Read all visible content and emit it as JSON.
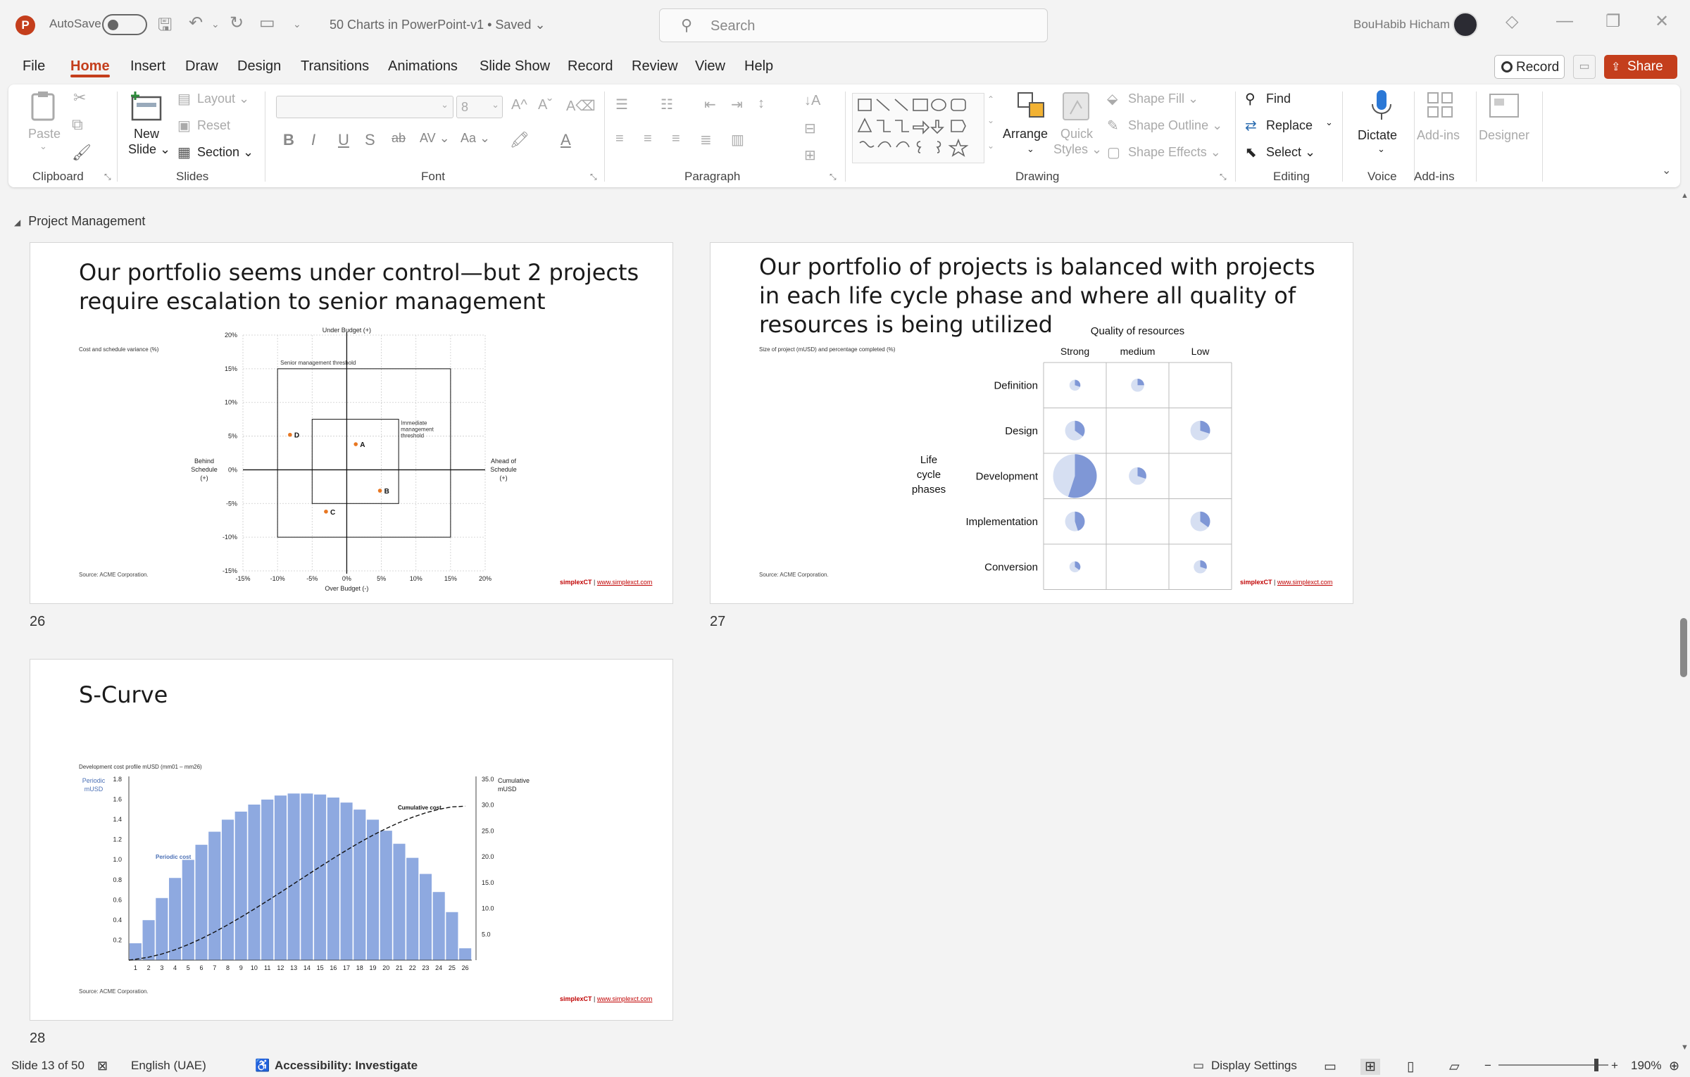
{
  "app": {
    "autosave_label": "AutoSave",
    "doc_title": "50 Charts in PowerPoint-v1 • Saved ⌄",
    "search_placeholder": "Search",
    "user_name": "BouHabib Hicham"
  },
  "menu": [
    "File",
    "Home",
    "Insert",
    "Draw",
    "Design",
    "Transitions",
    "Animations",
    "Slide Show",
    "Record",
    "Review",
    "View",
    "Help"
  ],
  "actions": {
    "record": "Record",
    "share": "Share"
  },
  "ribbon": {
    "clipboard": {
      "label": "Clipboard",
      "paste": "Paste"
    },
    "slides": {
      "label": "Slides",
      "new_slide_1": "New",
      "new_slide_2": "Slide ⌄",
      "layout": "Layout ⌄",
      "reset": "Reset",
      "section": "Section ⌄"
    },
    "font": {
      "label": "Font",
      "size": "8",
      "grow": "A^",
      "shrink": "Aˇ",
      "clear": "A⌫",
      "bold": "B",
      "italic": "I",
      "underline": "U",
      "shadow": "S",
      "strike": "ab",
      "spacing": "AV ⌄",
      "case": "Aa ⌄"
    },
    "paragraph": {
      "label": "Paragraph"
    },
    "drawing": {
      "label": "Drawing",
      "arrange": "Arrange",
      "quick_1": "Quick",
      "quick_2": "Styles ⌄",
      "fill": "Shape Fill ⌄",
      "outline": "Shape Outline ⌄",
      "effects": "Shape Effects ⌄"
    },
    "editing": {
      "label": "Editing",
      "find": "Find",
      "replace": "Replace",
      "select": "Select ⌄"
    },
    "voice": {
      "label": "Voice",
      "dictate": "Dictate"
    },
    "addins": {
      "label": "Add-ins",
      "addins": "Add-ins"
    },
    "designer": {
      "designer": "Designer"
    }
  },
  "section_title": "Project Management",
  "slides": [
    {
      "number": "26",
      "title_line1": "Our portfolio seems under control—but 2 projects",
      "title_line2": "require escalation to senior management",
      "subtitle": "Cost and schedule variance (%)",
      "source": "Source: ACME Corporation.",
      "chart_data": {
        "type": "scatter",
        "top_label": "Under Budget (+)",
        "bottom_label": "Over Budget (-)",
        "left_label": [
          "Behind",
          "Schedule",
          "(+)"
        ],
        "right_label": [
          "Ahead of",
          "Schedule",
          "(+)"
        ],
        "senior_threshold": "Senior management threshold",
        "immediate_threshold": [
          "Immediate",
          "management",
          "threshold"
        ],
        "x_ticks": [
          "-15%",
          "-10%",
          "-5%",
          "0%",
          "5%",
          "10%",
          "15%",
          "20%"
        ],
        "y_ticks": [
          "20%",
          "15%",
          "10%",
          "5%",
          "0%",
          "-5%",
          "-10%",
          "-15%"
        ],
        "xlim": [
          -15,
          20
        ],
        "ylim": [
          -15,
          20
        ],
        "senior_box": {
          "x": [
            -10,
            15
          ],
          "y": [
            -10,
            15
          ]
        },
        "immediate_box": {
          "x": [
            -5,
            7.5
          ],
          "y": [
            -5,
            7.5
          ]
        },
        "points": [
          {
            "label": "A",
            "x": 1.3,
            "y": 3.8
          },
          {
            "label": "B",
            "x": 4.8,
            "y": -3.1
          },
          {
            "label": "C",
            "x": -3.0,
            "y": -6.2
          },
          {
            "label": "D",
            "x": -8.2,
            "y": 5.2
          }
        ]
      }
    },
    {
      "number": "27",
      "title_line1": "Our portfolio of projects is balanced with projects",
      "title_line2": "in each life cycle phase and where all quality of",
      "title_line3": "resources is being utilized",
      "subtitle": "Size of project (mUSD) and percentage completed (%)",
      "source": "Source: ACME Corporation.",
      "chart_data": {
        "type": "table",
        "header": "Quality of resources",
        "row_title": [
          "Life",
          "cycle",
          "phases"
        ],
        "columns": [
          "Strong",
          "medium",
          "Low"
        ],
        "rows": [
          {
            "phase": "Definition",
            "cells": [
              {
                "size": 0.25,
                "pct": 0.3
              },
              {
                "size": 0.3,
                "pct": 0.25
              },
              null
            ]
          },
          {
            "phase": "Design",
            "cells": [
              {
                "size": 0.45,
                "pct": 0.35
              },
              null,
              {
                "size": 0.45,
                "pct": 0.3
              }
            ]
          },
          {
            "phase": "Development",
            "cells": [
              {
                "size": 1.0,
                "pct": 0.55
              },
              {
                "size": 0.4,
                "pct": 0.3
              },
              null
            ]
          },
          {
            "phase": "Implementation",
            "cells": [
              {
                "size": 0.45,
                "pct": 0.45
              },
              null,
              {
                "size": 0.45,
                "pct": 0.35
              }
            ]
          },
          {
            "phase": "Conversion",
            "cells": [
              {
                "size": 0.25,
                "pct": 0.35
              },
              null,
              {
                "size": 0.3,
                "pct": 0.3
              }
            ]
          }
        ]
      }
    },
    {
      "number": "28",
      "title_line1": "S-Curve",
      "subtitle": "Development cost profile mUSD (mm01 – mm26)",
      "source": "Source: ACME Corporation.",
      "chart_data": {
        "type": "bar",
        "y1_label": [
          "Periodic",
          "mUSD"
        ],
        "y2_label": [
          "Cumulative",
          "mUSD"
        ],
        "series_label_bars": "Periodic cost",
        "series_label_line": "Cumulative cost",
        "categories": [
          "1",
          "2",
          "3",
          "4",
          "5",
          "6",
          "7",
          "8",
          "9",
          "10",
          "11",
          "12",
          "13",
          "14",
          "15",
          "16",
          "17",
          "18",
          "19",
          "20",
          "21",
          "22",
          "23",
          "24",
          "25",
          "26"
        ],
        "y1_ticks": [
          "1.8",
          "1.6",
          "1.4",
          "1.2",
          "1.0",
          "0.8",
          "0.6",
          "0.4",
          "0.2"
        ],
        "y2_ticks": [
          "35.0",
          "30.0",
          "25.0",
          "20.0",
          "15.0",
          "10.0",
          "5.0"
        ],
        "ylim": [
          0,
          1.8
        ],
        "y2lim": [
          0,
          35
        ],
        "series": [
          {
            "name": "Periodic cost",
            "values": [
              0.17,
              0.4,
              0.62,
              0.82,
              1.0,
              1.15,
              1.28,
              1.4,
              1.48,
              1.55,
              1.6,
              1.64,
              1.66,
              1.66,
              1.65,
              1.62,
              1.57,
              1.5,
              1.4,
              1.29,
              1.16,
              1.02,
              0.86,
              0.68,
              0.48,
              0.12
            ]
          },
          {
            "name": "Cumulative cost",
            "values": [
              0.17,
              0.57,
              1.19,
              2.01,
              3.01,
              4.16,
              5.44,
              6.84,
              8.32,
              9.87,
              11.47,
              13.11,
              14.77,
              16.43,
              18.08,
              19.7,
              21.27,
              22.77,
              24.17,
              25.46,
              26.62,
              27.64,
              28.5,
              29.18,
              29.66,
              29.78
            ]
          }
        ]
      }
    }
  ],
  "brand": {
    "name": "simplexCT",
    "url": "www.simplexct.com"
  },
  "status": {
    "slide": "Slide 13 of 50",
    "language": "English (UAE)",
    "accessibility": "Accessibility: Investigate",
    "display": "Display Settings",
    "zoom": "190%"
  },
  "colors": {
    "accent": "#c43e1c",
    "pie_light": "#d6dff2",
    "pie_dark": "#7f97d6",
    "bar": "#8ea9e0",
    "orange": "#e87722"
  }
}
